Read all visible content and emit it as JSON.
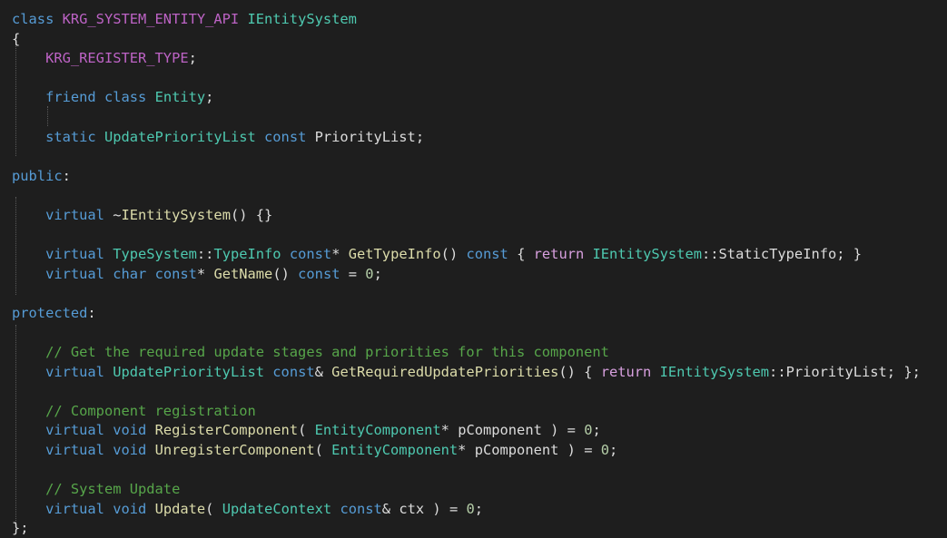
{
  "colors": {
    "background": "#1e1e1e",
    "keyword": "#569cd6",
    "type": "#4ec9b0",
    "function": "#dcdcaa",
    "macro": "#bd63c5",
    "comment": "#57a64a",
    "number": "#b5cea8",
    "access_specifier": "#569cd6",
    "control_keyword": "#d8a0df",
    "default": "#dcdcdc",
    "guide": "#5a5a5a"
  },
  "lines": [
    [
      [
        "class ",
        "keyword"
      ],
      [
        "KRG_SYSTEM_ENTITY_API ",
        "macro"
      ],
      [
        "IEntitySystem",
        "type"
      ]
    ],
    [
      [
        "{",
        "default"
      ]
    ],
    [
      [
        "    ",
        "default"
      ],
      [
        "KRG_REGISTER_TYPE",
        "macro"
      ],
      [
        ";",
        "default"
      ]
    ],
    [],
    [
      [
        "    ",
        "default"
      ],
      [
        "friend ",
        "keyword"
      ],
      [
        "class ",
        "keyword"
      ],
      [
        "Entity",
        "type"
      ],
      [
        ";",
        "default"
      ]
    ],
    [],
    [
      [
        "    ",
        "default"
      ],
      [
        "static ",
        "keyword"
      ],
      [
        "UpdatePriorityList ",
        "type"
      ],
      [
        "const ",
        "keyword"
      ],
      [
        "PriorityList",
        "default"
      ],
      [
        ";",
        "default"
      ]
    ],
    [],
    [
      [
        "public",
        "keyword"
      ],
      [
        ":",
        "default"
      ]
    ],
    [],
    [
      [
        "    ",
        "default"
      ],
      [
        "virtual ",
        "keyword"
      ],
      [
        "~",
        "default"
      ],
      [
        "IEntitySystem",
        "function"
      ],
      [
        "() {}",
        "default"
      ]
    ],
    [],
    [
      [
        "    ",
        "default"
      ],
      [
        "virtual ",
        "keyword"
      ],
      [
        "TypeSystem",
        "type"
      ],
      [
        "::",
        "default"
      ],
      [
        "TypeInfo ",
        "type"
      ],
      [
        "const",
        "keyword"
      ],
      [
        "* ",
        "default"
      ],
      [
        "GetTypeInfo",
        "function"
      ],
      [
        "() ",
        "default"
      ],
      [
        "const ",
        "keyword"
      ],
      [
        "{ ",
        "default"
      ],
      [
        "return ",
        "control_keyword"
      ],
      [
        "IEntitySystem",
        "type"
      ],
      [
        "::",
        "default"
      ],
      [
        "StaticTypeInfo",
        "default"
      ],
      [
        "; }",
        "default"
      ]
    ],
    [
      [
        "    ",
        "default"
      ],
      [
        "virtual ",
        "keyword"
      ],
      [
        "char ",
        "keyword"
      ],
      [
        "const",
        "keyword"
      ],
      [
        "* ",
        "default"
      ],
      [
        "GetName",
        "function"
      ],
      [
        "() ",
        "default"
      ],
      [
        "const ",
        "keyword"
      ],
      [
        "= ",
        "default"
      ],
      [
        "0",
        "number"
      ],
      [
        ";",
        "default"
      ]
    ],
    [],
    [
      [
        "protected",
        "keyword"
      ],
      [
        ":",
        "default"
      ]
    ],
    [],
    [
      [
        "    ",
        "default"
      ],
      [
        "// Get the required update stages and priorities for this component",
        "comment"
      ]
    ],
    [
      [
        "    ",
        "default"
      ],
      [
        "virtual ",
        "keyword"
      ],
      [
        "UpdatePriorityList ",
        "type"
      ],
      [
        "const",
        "keyword"
      ],
      [
        "& ",
        "default"
      ],
      [
        "GetRequiredUpdatePriorities",
        "function"
      ],
      [
        "() { ",
        "default"
      ],
      [
        "return ",
        "control_keyword"
      ],
      [
        "IEntitySystem",
        "type"
      ],
      [
        "::",
        "default"
      ],
      [
        "PriorityList",
        "default"
      ],
      [
        "; };",
        "default"
      ]
    ],
    [],
    [
      [
        "    ",
        "default"
      ],
      [
        "// Component registration",
        "comment"
      ]
    ],
    [
      [
        "    ",
        "default"
      ],
      [
        "virtual ",
        "keyword"
      ],
      [
        "void ",
        "keyword"
      ],
      [
        "RegisterComponent",
        "function"
      ],
      [
        "( ",
        "default"
      ],
      [
        "EntityComponent",
        "type"
      ],
      [
        "* ",
        "default"
      ],
      [
        "pComponent ",
        "default"
      ],
      [
        ") = ",
        "default"
      ],
      [
        "0",
        "number"
      ],
      [
        ";",
        "default"
      ]
    ],
    [
      [
        "    ",
        "default"
      ],
      [
        "virtual ",
        "keyword"
      ],
      [
        "void ",
        "keyword"
      ],
      [
        "UnregisterComponent",
        "function"
      ],
      [
        "( ",
        "default"
      ],
      [
        "EntityComponent",
        "type"
      ],
      [
        "* ",
        "default"
      ],
      [
        "pComponent ",
        "default"
      ],
      [
        ") = ",
        "default"
      ],
      [
        "0",
        "number"
      ],
      [
        ";",
        "default"
      ]
    ],
    [],
    [
      [
        "    ",
        "default"
      ],
      [
        "// System Update",
        "comment"
      ]
    ],
    [
      [
        "    ",
        "default"
      ],
      [
        "virtual ",
        "keyword"
      ],
      [
        "void ",
        "keyword"
      ],
      [
        "Update",
        "function"
      ],
      [
        "( ",
        "default"
      ],
      [
        "UpdateContext ",
        "type"
      ],
      [
        "const",
        "keyword"
      ],
      [
        "& ",
        "default"
      ],
      [
        "ctx ",
        "default"
      ],
      [
        ") = ",
        "default"
      ],
      [
        "0",
        "number"
      ],
      [
        ";",
        "default"
      ]
    ],
    [
      [
        "};",
        "default"
      ]
    ]
  ]
}
